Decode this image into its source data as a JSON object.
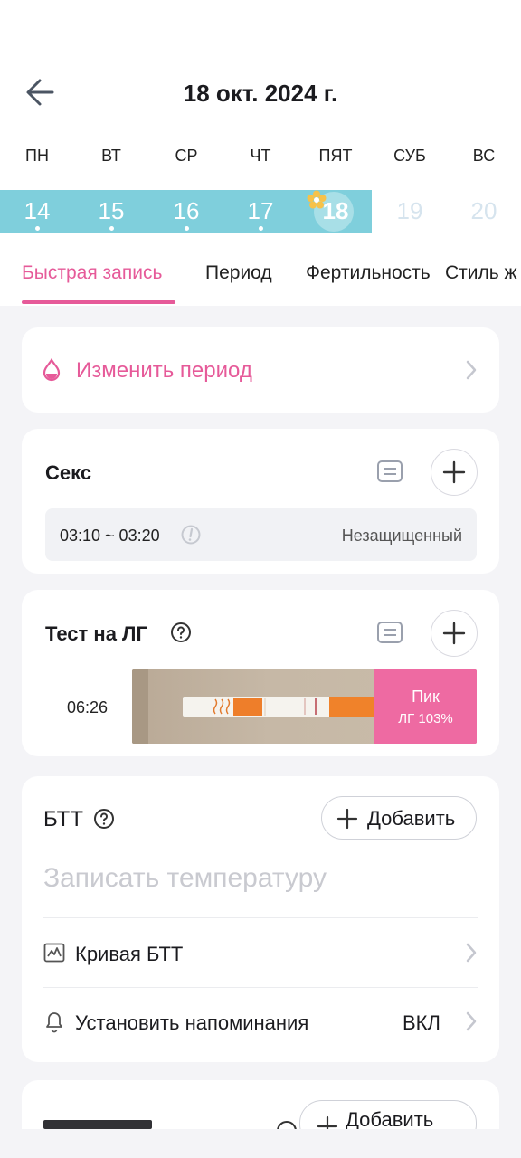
{
  "header": {
    "title": "18 окт. 2024 г."
  },
  "week": {
    "weekdays": [
      "ПН",
      "ВТ",
      "СР",
      "ЧТ",
      "ПЯТ",
      "СУБ",
      "ВС"
    ],
    "days": [
      "14",
      "15",
      "16",
      "17",
      "18",
      "19",
      "20"
    ]
  },
  "tabs": [
    "Быстрая запись",
    "Период",
    "Фертильность",
    "Стиль ж"
  ],
  "period_card": {
    "label": "Изменить период"
  },
  "sex_card": {
    "title": "Секс",
    "entry": {
      "time": "03:10 ~ 03:20",
      "status": "Незащищенный"
    }
  },
  "lh_card": {
    "title": "Тест на ЛГ",
    "entry": {
      "time": "06:26",
      "result": "Пик",
      "value": "ЛГ 103%"
    }
  },
  "bbt_card": {
    "title": "БТТ",
    "add_label": "Добавить",
    "placeholder": "Записать температуру",
    "curve_label": "Кривая БТТ",
    "reminder_label": "Установить напоминания",
    "reminder_value": "ВКЛ"
  },
  "next_card": {
    "add_label": "Добавить"
  },
  "colors": {
    "accent": "#e65a99",
    "band": "#7fcfdc"
  }
}
